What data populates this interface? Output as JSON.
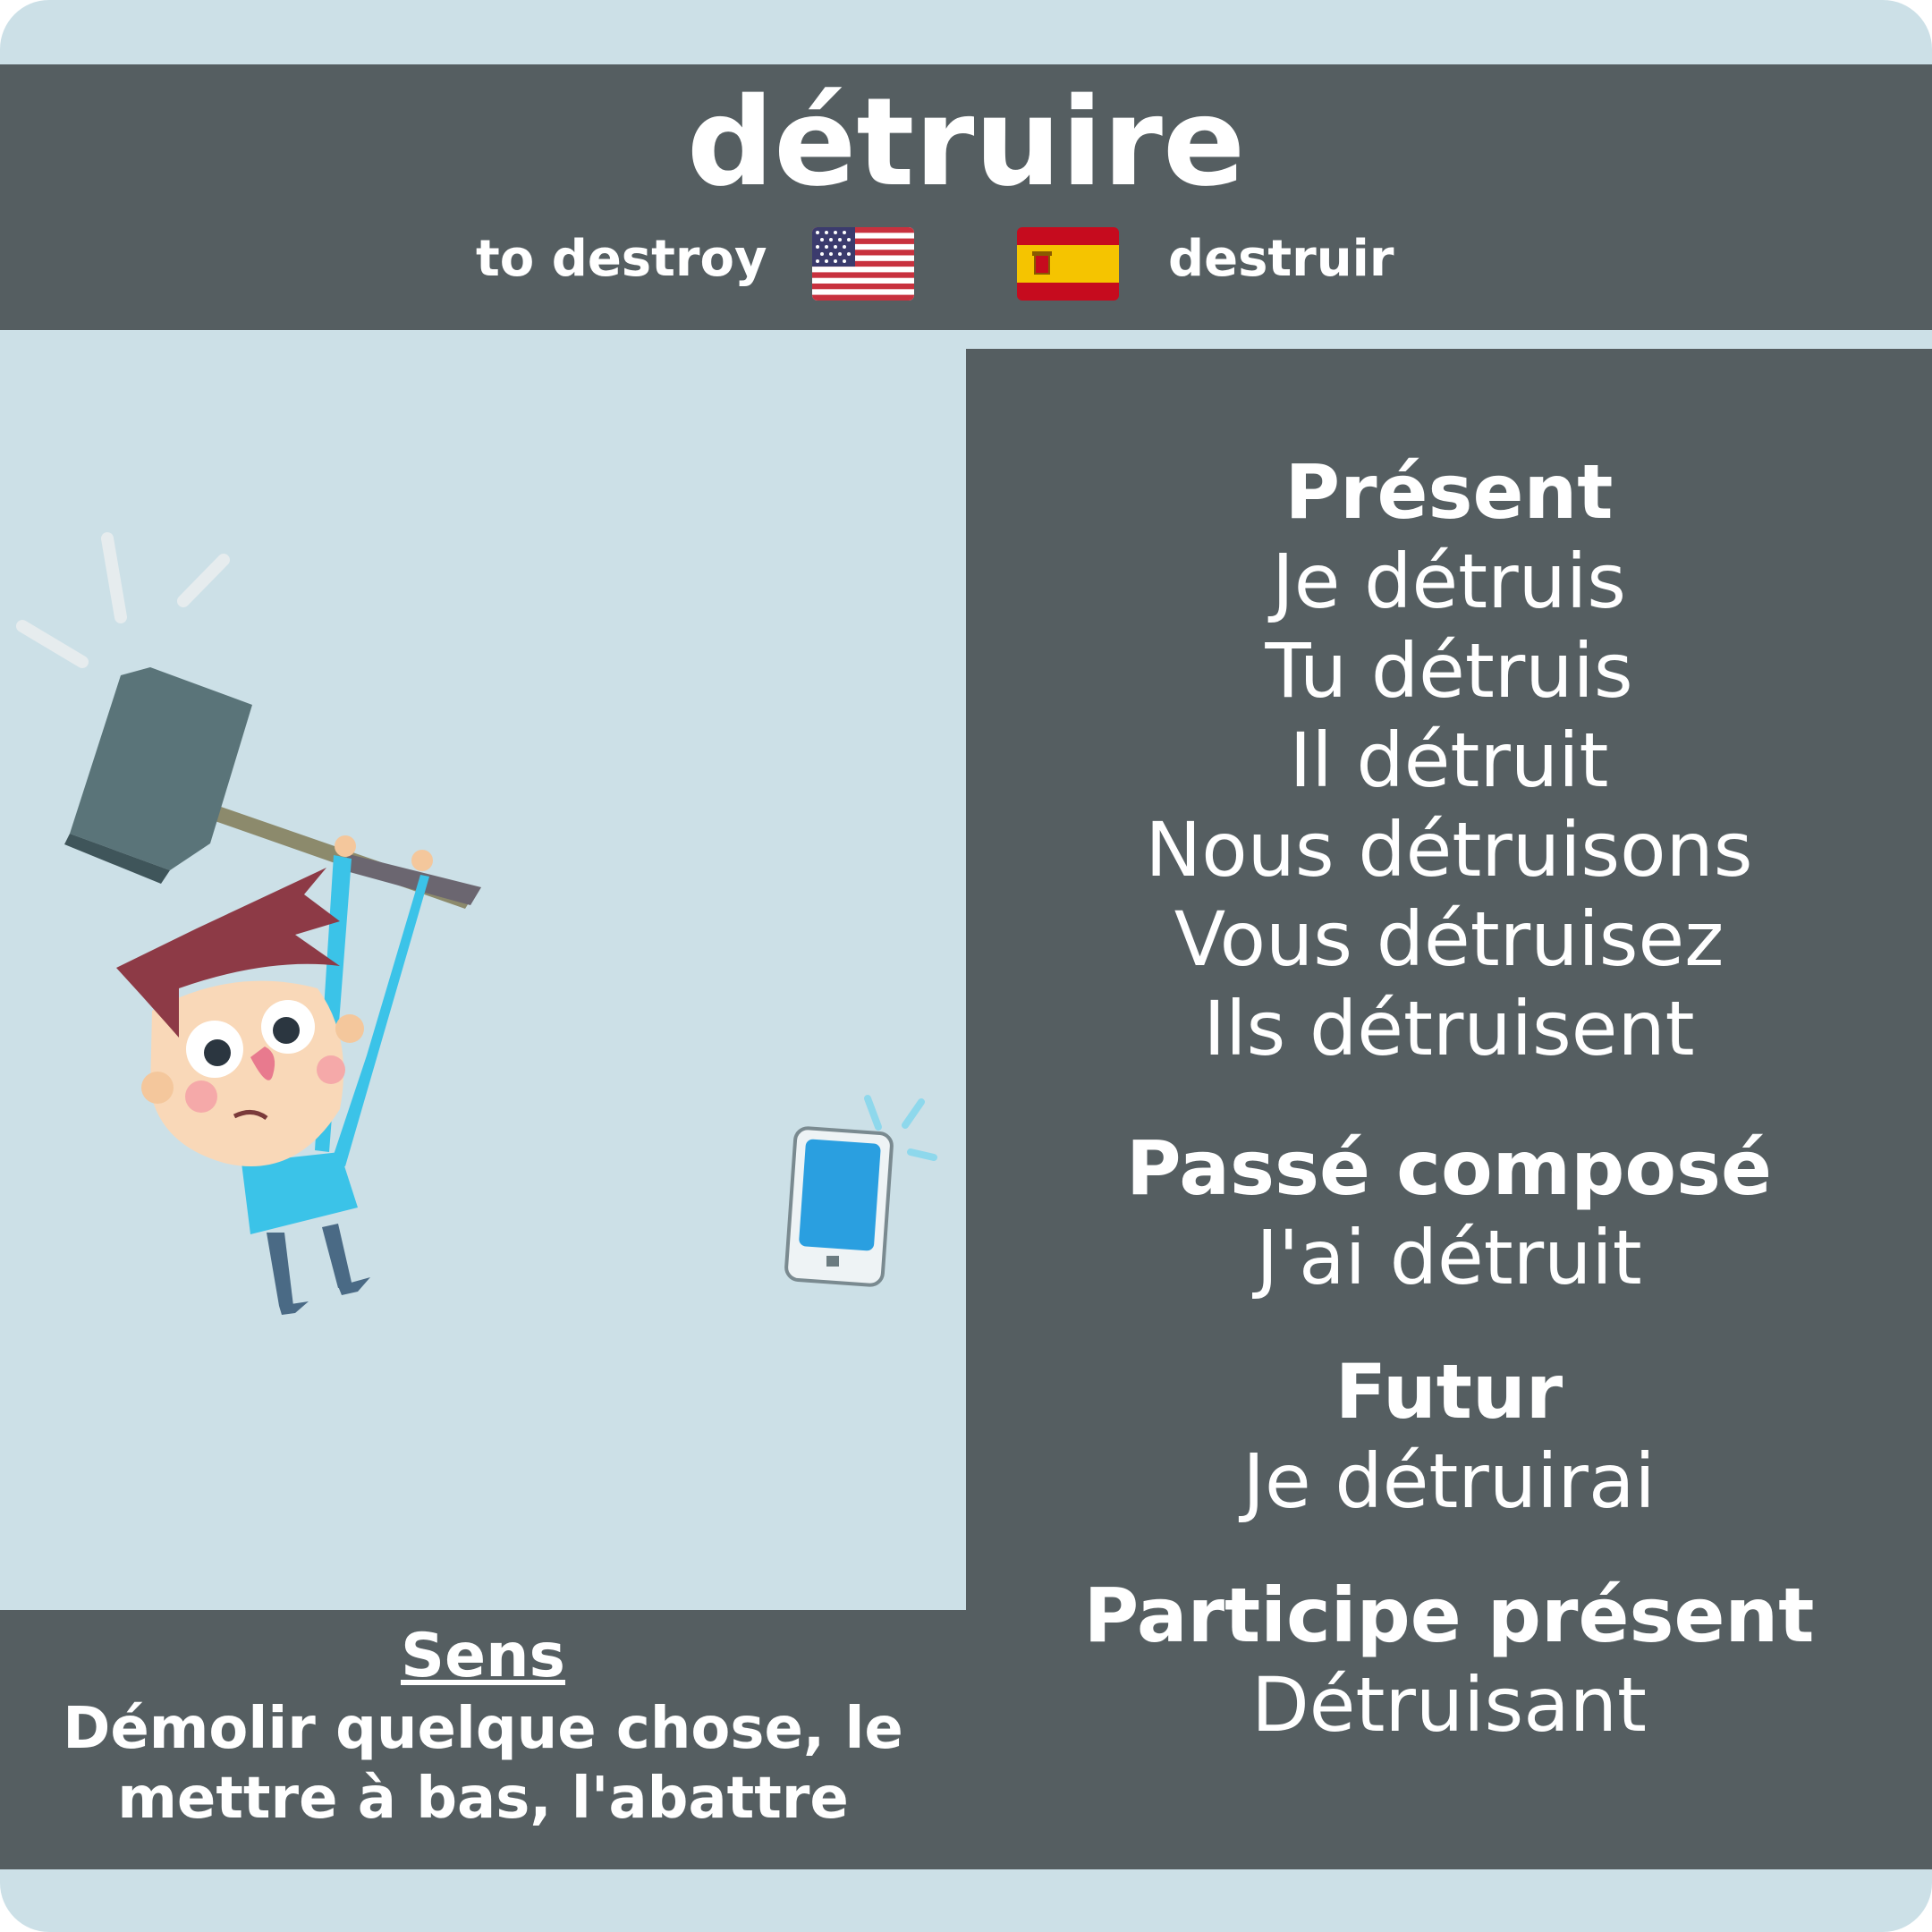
{
  "verb": "détruire",
  "translations": {
    "english": "to destroy",
    "spanish": "destruir",
    "english_flag_icon": "us-flag-icon",
    "spanish_flag_icon": "spain-flag-icon"
  },
  "conjugation": {
    "present": {
      "heading": "Présent",
      "forms": [
        "Je détruis",
        "Tu détruis",
        "Il détruit",
        "Nous détruisons",
        "Vous détruisez",
        "Ils détruisent"
      ]
    },
    "passe_compose": {
      "heading": "Passé composé",
      "form": "J'ai détruit"
    },
    "futur": {
      "heading": "Futur",
      "form": "Je détruirai"
    },
    "participe_present": {
      "heading": "Participe présent",
      "form": "Détruisant"
    }
  },
  "sens": {
    "heading": "Sens",
    "text_line1": "Démolir quelque chose, le",
    "text_line2": "mettre à bas, l'abattre"
  },
  "colors": {
    "background": "#cce0e7",
    "panel": "#555e61",
    "text": "#ffffff"
  },
  "illustration": {
    "subject": "man-with-sledgehammer-illustration",
    "object": "smartphone-icon"
  }
}
